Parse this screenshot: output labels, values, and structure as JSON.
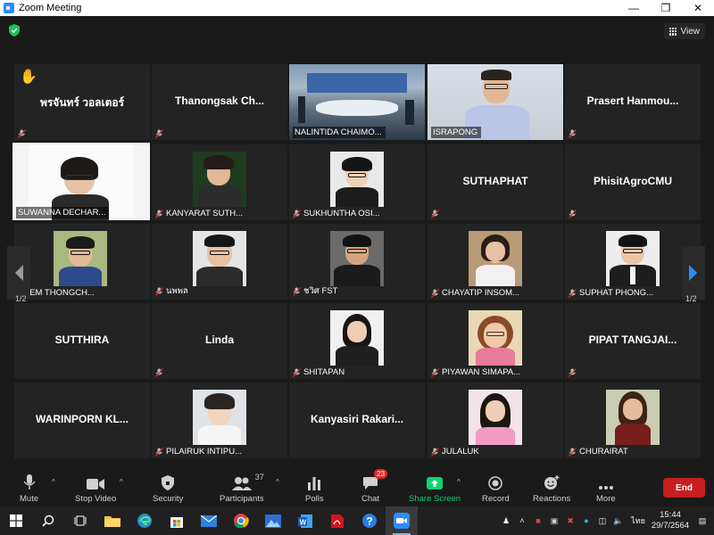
{
  "window": {
    "title": "Zoom Meeting"
  },
  "view_label": "View",
  "participants": [
    {
      "name": "พรจันทร์ วอลเตอร์",
      "display": "name",
      "hand": true
    },
    {
      "name": "Thanongsak Ch...",
      "display": "name"
    },
    {
      "name": "NALINTIDA CHAIMO...",
      "display": "video"
    },
    {
      "name": "ISRAPONG",
      "display": "video"
    },
    {
      "name": "Prasert Hanmou...",
      "display": "name"
    },
    {
      "name": "SUWANNA DECHAR...",
      "display": "video",
      "active": true
    },
    {
      "name": "KANYARAT SUTH...",
      "display": "photo"
    },
    {
      "name": "SUKHUNTHA OSI...",
      "display": "photo"
    },
    {
      "name": "SUTHAPHAT",
      "display": "name"
    },
    {
      "name": "PhisitAgroCMU",
      "display": "name"
    },
    {
      "name": "PREM THONGCH...",
      "display": "photo"
    },
    {
      "name": "นพพล",
      "display": "photo"
    },
    {
      "name": "ชวิศ FST",
      "display": "photo"
    },
    {
      "name": "CHAYATIP INSOM...",
      "display": "photo"
    },
    {
      "name": "SUPHAT PHONG...",
      "display": "photo"
    },
    {
      "name": "SUTTHIRA",
      "display": "name"
    },
    {
      "name": "Linda",
      "display": "name"
    },
    {
      "name": "SHITAPAN",
      "display": "photo"
    },
    {
      "name": "PIYAWAN SIMAPA...",
      "display": "photo"
    },
    {
      "name": "PIPAT TANGJAI...",
      "display": "name"
    },
    {
      "name": "WARINPORN KL...",
      "display": "name"
    },
    {
      "name": "PILAIRUK INTIPU...",
      "display": "photo"
    },
    {
      "name": "Kanyasiri Rakari...",
      "display": "name"
    },
    {
      "name": "JULALUK",
      "display": "photo"
    },
    {
      "name": "CHURAIRAT",
      "display": "photo"
    }
  ],
  "pagination": {
    "left": "1/2",
    "right": "1/2"
  },
  "toolbar": {
    "mute": "Mute",
    "stop_video": "Stop Video",
    "security": "Security",
    "participants": "Participants",
    "participants_count": "37",
    "polls": "Polls",
    "chat": "Chat",
    "chat_badge": "23",
    "share_screen": "Share Screen",
    "record": "Record",
    "reactions": "Reactions",
    "more": "More",
    "end": "End"
  },
  "taskbar": {
    "language": "ไทย",
    "time": "15:44",
    "date": "29/7/2564"
  },
  "colors": {
    "background": "#1a1a1a",
    "tile": "#232323",
    "active_border": "#e8f0a0",
    "share_green": "#0ed36e",
    "end_red": "#c81e1e",
    "muted_red": "#e02828"
  }
}
